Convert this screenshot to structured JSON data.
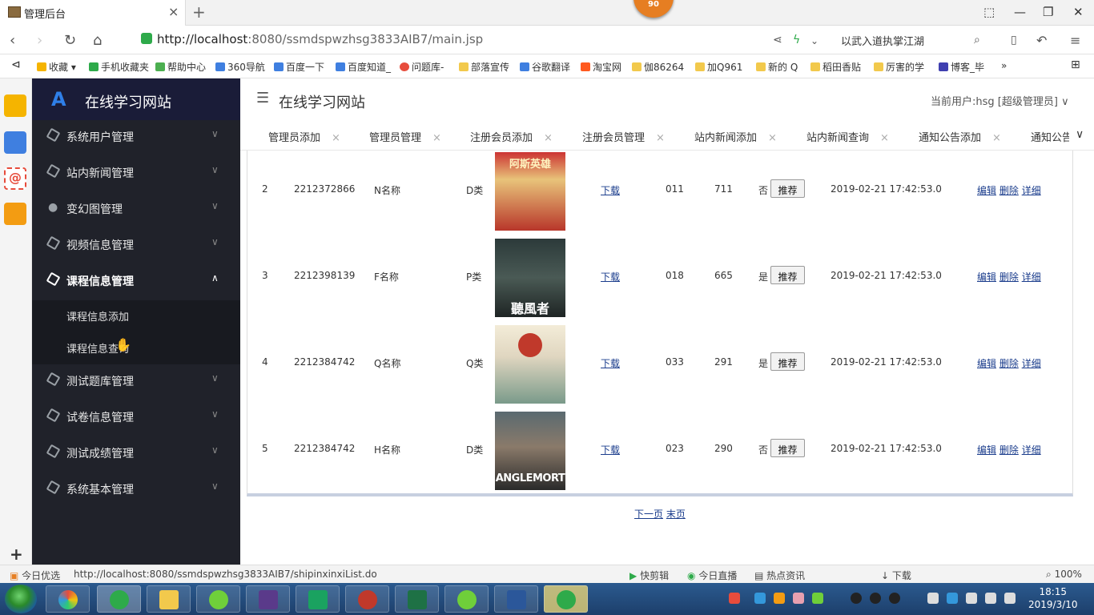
{
  "browser": {
    "tab_title": "管理后台",
    "tab_close": "×",
    "new_tab": "+",
    "badge": "90",
    "url_host": "http://localhost",
    "url_rest": ":8080/ssmdspwzhsg3833AIB7/main.jsp",
    "search_text": "以武入道执掌江湖",
    "bookmarks": [
      "收藏",
      "手机收藏夹",
      "帮助中心",
      "360导航",
      "百度一下",
      "百度知道_",
      "问题库-",
      "部落宣传",
      "谷歌翻译",
      "淘宝网",
      "伽86264",
      "加Q961",
      "新的 Q",
      "稻田香贴",
      "厉害的学",
      "博客_毕"
    ]
  },
  "sidebar": {
    "brand": "在线学习网站",
    "menus": [
      {
        "label": "系统用户管理",
        "icon": "cube-icon"
      },
      {
        "label": "站内新闻管理",
        "icon": "cube-icon"
      },
      {
        "label": "变幻图管理",
        "icon": "user-icon"
      },
      {
        "label": "视频信息管理",
        "icon": "cube-icon"
      },
      {
        "label": "课程信息管理",
        "icon": "cube-icon"
      },
      {
        "label": "测试题库管理",
        "icon": "cube-icon"
      },
      {
        "label": "试卷信息管理",
        "icon": "cube-icon"
      },
      {
        "label": "测试成绩管理",
        "icon": "cube-icon"
      },
      {
        "label": "系统基本管理",
        "icon": "cube-icon"
      }
    ],
    "submenu": [
      "课程信息添加",
      "课程信息查询"
    ]
  },
  "header": {
    "title": "在线学习网站",
    "current_user": "当前用户:hsg [超级管理员]"
  },
  "tabs": [
    "管理员添加",
    "管理员管理",
    "注册会员添加",
    "注册会员管理",
    "站内新闻添加",
    "站内新闻查询",
    "通知公告添加",
    "通知公告"
  ],
  "rows": [
    {
      "no": "2",
      "code": "2212372866",
      "name": "N名称",
      "type": "D类",
      "download": "下载",
      "num": "011",
      "count": "711",
      "recommended": "否",
      "btn": "推荐",
      "date": "2019-02-21 17:42:53.0"
    },
    {
      "no": "3",
      "code": "2212398139",
      "name": "F名称",
      "type": "P类",
      "download": "下载",
      "num": "018",
      "count": "665",
      "recommended": "是",
      "btn": "推荐",
      "date": "2019-02-21 17:42:53.0"
    },
    {
      "no": "4",
      "code": "2212384742",
      "name": "Q名称",
      "type": "Q类",
      "download": "下载",
      "num": "033",
      "count": "291",
      "recommended": "是",
      "btn": "推荐",
      "date": "2019-02-21 17:42:53.0"
    },
    {
      "no": "5",
      "code": "2212384742",
      "name": "H名称",
      "type": "D类",
      "download": "下载",
      "num": "023",
      "count": "290",
      "recommended": "否",
      "btn": "推荐",
      "date": "2019-02-21 17:42:53.0"
    }
  ],
  "row_actions": {
    "edit": "编辑",
    "delete": "删除",
    "detail": "详细"
  },
  "poster_texts": [
    "阿斯英雄",
    "聽風者",
    "",
    "ANGLEMORT"
  ],
  "pager": {
    "next": "下一页",
    "last": "末页"
  },
  "statusbar": {
    "left": "今日优选",
    "url": "http://localhost:8080/ssmdspwzhsg3833AIB7/shipinxinxiList.do",
    "items": [
      "快剪辑",
      "今日直播",
      "热点资讯",
      "下载"
    ],
    "zoom": "100%"
  },
  "taskbar": {
    "time": "18:15",
    "date": "2019/3/10"
  }
}
